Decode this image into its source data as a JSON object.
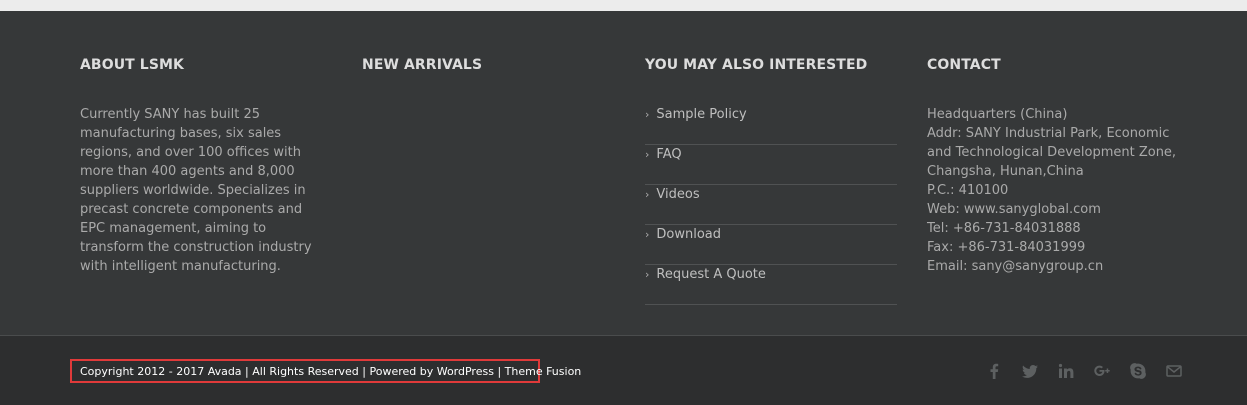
{
  "footer": {
    "about": {
      "heading": "ABOUT LSMK",
      "text": "Currently SANY has built 25 manufacturing bases, six sales regions, and over 100 offices with more than 400 agents and 8,000 suppliers worldwide. Specializes in precast concrete components and EPC management, aiming to transform the construction industry with intelligent manufacturing."
    },
    "new_arrivals": {
      "heading": "NEW ARRIVALS"
    },
    "interested": {
      "heading": "YOU MAY ALSO INTERESTED",
      "links": [
        "Sample Policy",
        "FAQ",
        "Videos",
        "Download",
        "Request A Quote"
      ]
    },
    "contact": {
      "heading": "CONTACT",
      "headquarters": "Headquarters (China)",
      "address": "Addr: SANY Industrial Park, Economic and Technological Development Zone, Changsha, Hunan,China",
      "postcode": "P.C.: 410100",
      "web": "Web: www.sanyglobal.com",
      "tel": "Tel: +86-731-84031888",
      "fax": "Fax: +86-731-84031999",
      "email": "Email: sany@sanygroup.cn"
    }
  },
  "bottom_bar": {
    "copyright": "Copyright 2012 - 2017 Avada | All Rights Reserved | Powered by WordPress | Theme Fusion",
    "socials": [
      "facebook-icon",
      "twitter-icon",
      "linkedin-icon",
      "google-plus-icon",
      "skype-icon",
      "email-icon"
    ]
  },
  "colors": {
    "footer_bg": "#363839",
    "bottom_bg": "#2d2e2f",
    "highlight_border": "#e03a3a"
  }
}
